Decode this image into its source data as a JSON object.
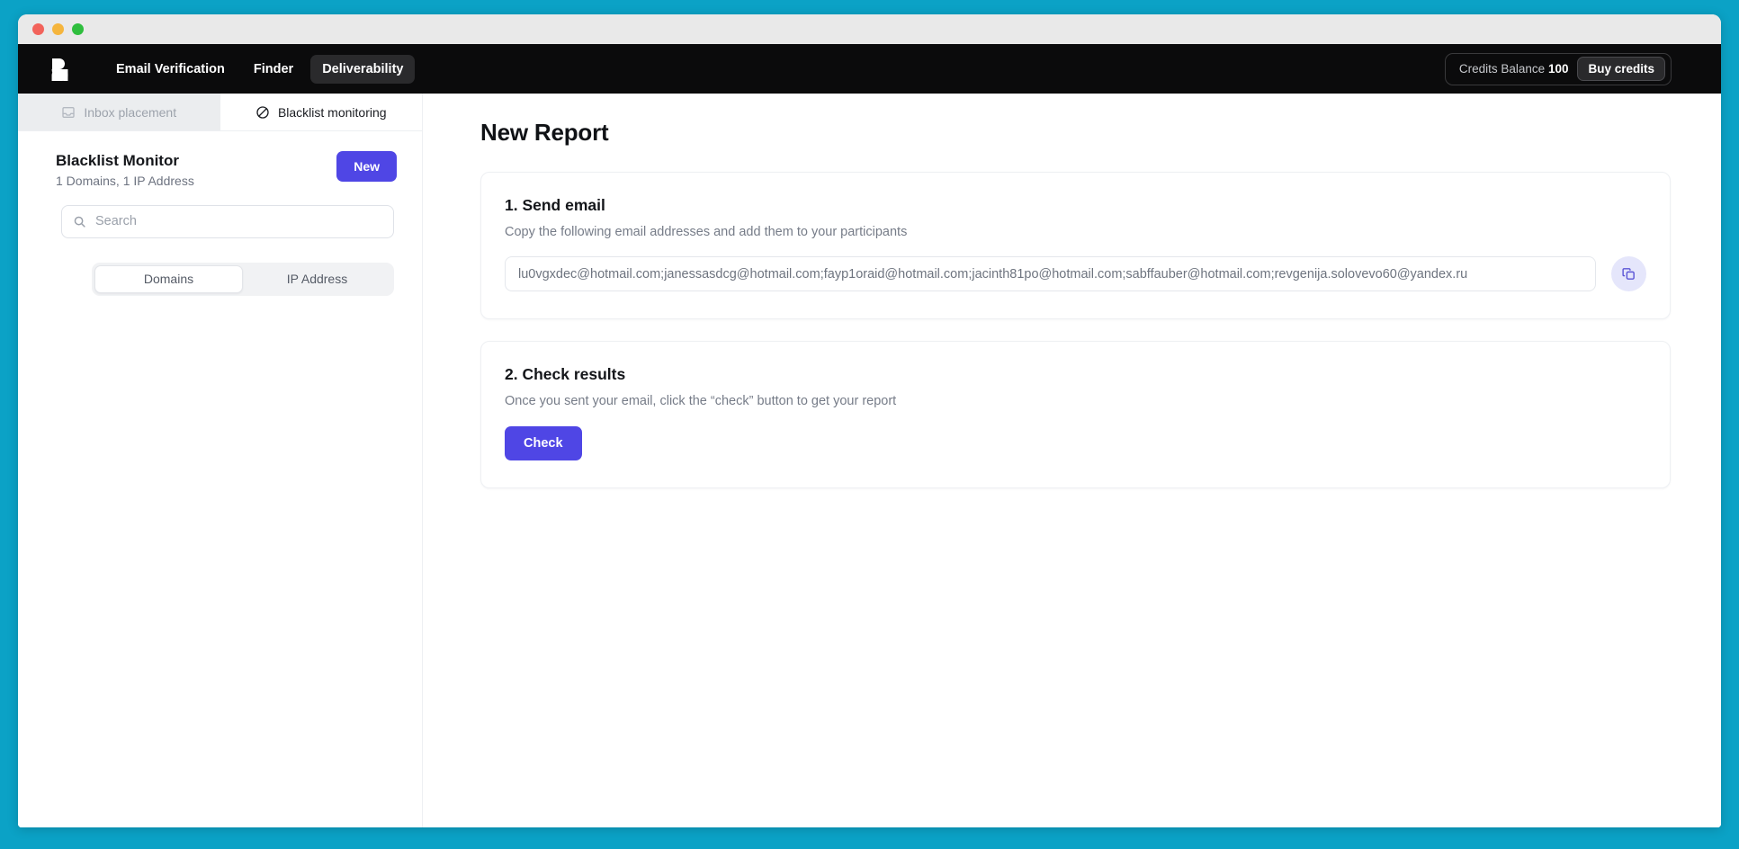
{
  "window": {
    "traffic_lights": [
      "close",
      "minimize",
      "zoom"
    ]
  },
  "topnav": {
    "logo_name": "bouncer-logo",
    "links": [
      {
        "label": "Email Verification",
        "active": false
      },
      {
        "label": "Finder",
        "active": false
      },
      {
        "label": "Deliverability",
        "active": true
      }
    ],
    "credits_label": "Credits Balance",
    "credits_value": "100",
    "buy_credits_label": "Buy credits"
  },
  "sidebar": {
    "tabs": [
      {
        "label": "Inbox placement",
        "icon": "inbox-icon",
        "active": false
      },
      {
        "label": "Blacklist monitoring",
        "icon": "ban-icon",
        "active": true
      }
    ],
    "monitor_title": "Blacklist Monitor",
    "monitor_subtitle": "1 Domains, 1 IP Address",
    "new_button_label": "New",
    "search_placeholder": "Search",
    "search_value": "",
    "search_icon": "search-icon",
    "segments": [
      {
        "label": "Domains",
        "active": true
      },
      {
        "label": "IP Address",
        "active": false
      }
    ]
  },
  "main": {
    "page_title": "New Report",
    "sections": [
      {
        "title": "1. Send email",
        "subtitle": "Copy the following email addresses and add them to your participants",
        "emails_value": "lu0vgxdec@hotmail.com;janessasdcg@hotmail.com;fayp1oraid@hotmail.com;jacinth81po@hotmail.com;sabffauber@hotmail.com;revgenija.solovevo60@yandex.ru",
        "copy_icon": "copy-icon"
      },
      {
        "title": "2. Check results",
        "subtitle": "Once you sent your email, click the “check” button to get your report",
        "button_label": "Check"
      }
    ]
  },
  "colors": {
    "desktop_background": "#0BA2C6",
    "topnav_background": "#0B0B0C",
    "accent_indigo": "#4F46E5",
    "copy_button_background": "#E5E6FB",
    "tab_inactive_background": "#EBEDEF"
  }
}
